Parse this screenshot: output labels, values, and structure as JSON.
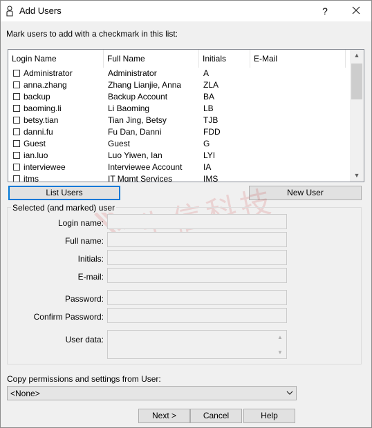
{
  "window": {
    "title": "Add Users",
    "help_label": "?",
    "icon": "user-icon"
  },
  "instruction": "Mark users to add with a checkmark in this list:",
  "user_list": {
    "columns": [
      "Login Name",
      "Full Name",
      "Initials",
      "E-Mail"
    ],
    "rows": [
      {
        "login": "Administrator",
        "full": "Administrator",
        "initials": "A",
        "email": "",
        "checked": false
      },
      {
        "login": "anna.zhang",
        "full": "Zhang Lianjie, Anna",
        "initials": "ZLA",
        "email": "",
        "checked": false
      },
      {
        "login": "backup",
        "full": "Backup Account",
        "initials": "BA",
        "email": "",
        "checked": false
      },
      {
        "login": "baoming.li",
        "full": "Li Baoming",
        "initials": "LB",
        "email": "",
        "checked": false
      },
      {
        "login": "betsy.tian",
        "full": "Tian Jing, Betsy",
        "initials": "TJB",
        "email": "",
        "checked": false
      },
      {
        "login": "danni.fu",
        "full": "Fu Dan, Danni",
        "initials": "FDD",
        "email": "",
        "checked": false
      },
      {
        "login": "Guest",
        "full": "Guest",
        "initials": "G",
        "email": "",
        "checked": false
      },
      {
        "login": "ian.luo",
        "full": "Luo Yiwen, Ian",
        "initials": "LYI",
        "email": "",
        "checked": false
      },
      {
        "login": "interviewee",
        "full": "Interviewee Account",
        "initials": "IA",
        "email": "",
        "checked": false
      },
      {
        "login": "itms",
        "full": "IT Mgmt Services",
        "initials": "IMS",
        "email": "",
        "checked": false
      }
    ]
  },
  "buttons": {
    "list_users": "List Users",
    "new_user": "New User",
    "next": "Next >",
    "cancel": "Cancel",
    "help": "Help"
  },
  "selected_group": {
    "title": "Selected (and marked) user",
    "login_label": "Login name:",
    "full_label": "Full name:",
    "initials_label": "Initials:",
    "email_label": "E-mail:",
    "password_label": "Password:",
    "confirm_label": "Confirm Password:",
    "userdata_label": "User data:",
    "login_value": "",
    "full_value": "",
    "initials_value": "",
    "email_value": "",
    "password_value": "",
    "confirm_value": "",
    "userdata_value": ""
  },
  "copy": {
    "label": "Copy permissions and settings from User:",
    "selected": "<None>"
  },
  "watermark": {
    "text": "生信科技"
  },
  "colors": {
    "accent": "#0078d7",
    "watermark": "#c00000"
  }
}
